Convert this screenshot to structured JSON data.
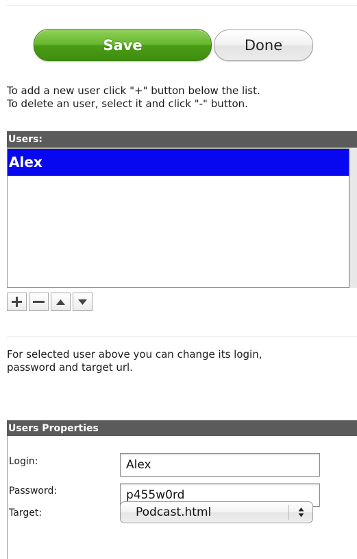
{
  "toolbar": {
    "save_label": "Save",
    "done_label": "Done"
  },
  "users_section": {
    "hint_line_1": "To add a new user click \"+\" button below the list.",
    "hint_line_2": "To delete an user, select it and click \"-\" button.",
    "header": "Users:",
    "items": [
      {
        "label": "Alex",
        "selected": true
      }
    ],
    "buttons": [
      {
        "name": "add-user-button",
        "icon": "plus-icon"
      },
      {
        "name": "remove-user-button",
        "icon": "minus-icon"
      },
      {
        "name": "move-up-button",
        "icon": "triangle-up-icon"
      },
      {
        "name": "move-down-button",
        "icon": "triangle-down-icon"
      }
    ]
  },
  "properties_section": {
    "hint_line_1": "For selected user above you can change its login,",
    "hint_line_2": "password and target url.",
    "header": "Users Properties",
    "login": {
      "label": "Login:",
      "value": "Alex"
    },
    "password": {
      "label": "Password:",
      "value": "p455w0rd"
    },
    "target": {
      "label": "Target:",
      "selected": "Podcast.html"
    }
  },
  "colors": {
    "save_green": "#5aac22",
    "selection_blue": "#0808f0",
    "section_header_gray": "#5b5b5b"
  }
}
